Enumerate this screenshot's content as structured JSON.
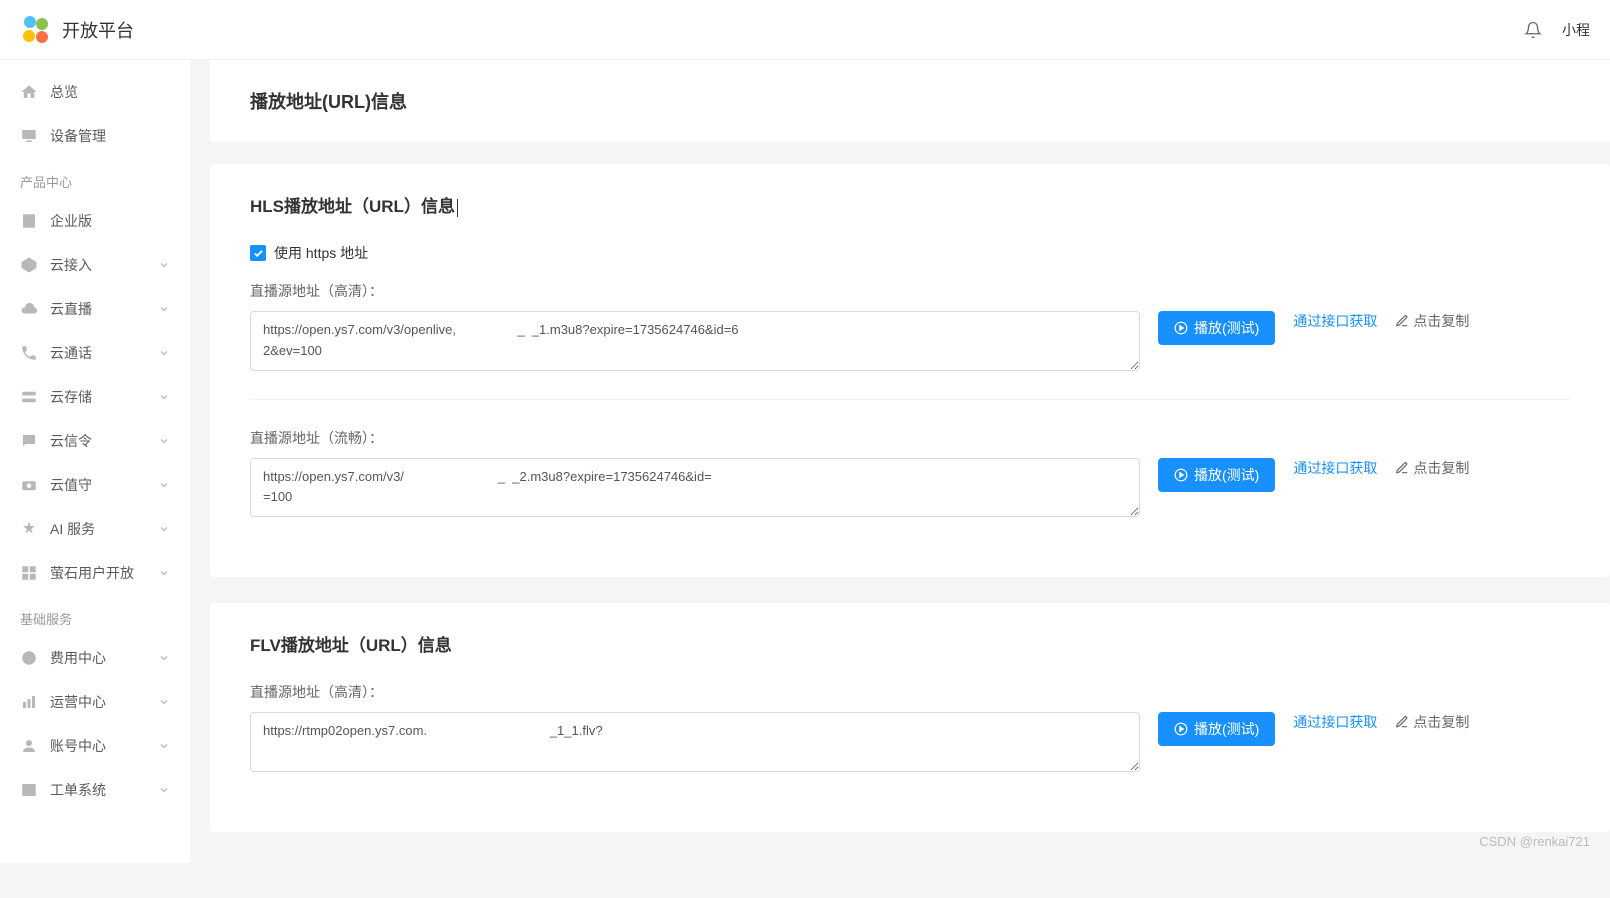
{
  "header": {
    "platform_title": "开放平台",
    "user_label": "小程"
  },
  "sidebar": {
    "items": [
      {
        "label": "总览",
        "icon": "home",
        "expandable": false
      },
      {
        "label": "设备管理",
        "icon": "device",
        "expandable": false
      }
    ],
    "section_product": "产品中心",
    "product_items": [
      {
        "label": "企业版",
        "icon": "enterprise",
        "expandable": false
      },
      {
        "label": "云接入",
        "icon": "cloud-access",
        "expandable": true
      },
      {
        "label": "云直播",
        "icon": "cloud-live",
        "expandable": true
      },
      {
        "label": "云通话",
        "icon": "cloud-call",
        "expandable": true
      },
      {
        "label": "云存储",
        "icon": "cloud-storage",
        "expandable": true
      },
      {
        "label": "云信令",
        "icon": "cloud-signal",
        "expandable": true
      },
      {
        "label": "云值守",
        "icon": "cloud-guard",
        "expandable": true
      },
      {
        "label": "AI 服务",
        "icon": "ai",
        "expandable": true
      },
      {
        "label": "萤石用户开放",
        "icon": "user-open",
        "expandable": true
      }
    ],
    "section_basic": "基础服务",
    "basic_items": [
      {
        "label": "费用中心",
        "icon": "fee",
        "expandable": true
      },
      {
        "label": "运营中心",
        "icon": "ops",
        "expandable": true
      },
      {
        "label": "账号中心",
        "icon": "account",
        "expandable": true
      },
      {
        "label": "工单系统",
        "icon": "ticket",
        "expandable": true
      }
    ]
  },
  "main": {
    "page_title": "播放地址(URL)信息",
    "hls": {
      "title": "HLS播放地址（URL）信息",
      "checkbox_label": "使用 https 地址",
      "hd_label": "直播源地址（高清）：",
      "hd_url": "https://open.ys7.com/v3/openlive,                 _  _1.m3u8?expire=1735624746&id=6                                                                                                                    2&ev=100",
      "sd_label": "直播源地址（流畅）：",
      "sd_url": "https://open.ys7.com/v3/                          _  _2.m3u8?expire=1735624746&id=                                                                                                                     =100"
    },
    "flv": {
      "title": "FLV播放地址（URL）信息",
      "hd_label": "直播源地址（高清）：",
      "hd_url": "https://rtmp02open.ys7.com.                                  _1_1.flv?"
    },
    "actions": {
      "play_test": "播放(测试)",
      "api_get": "通过接口获取",
      "copy": "点击复制"
    }
  },
  "watermark": "CSDN @renkai721"
}
